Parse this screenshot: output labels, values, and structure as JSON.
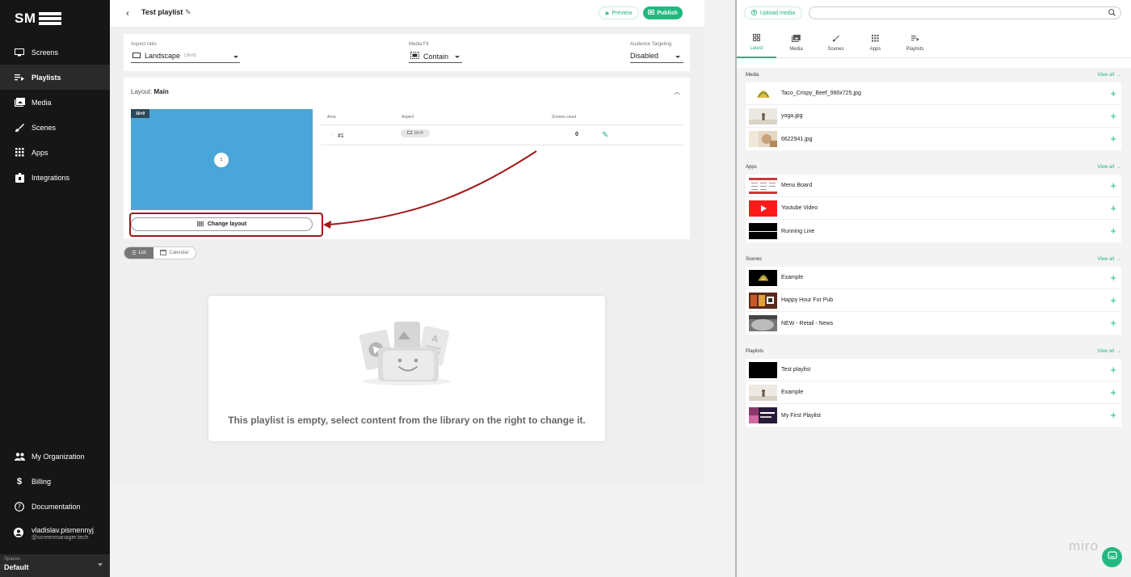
{
  "brand": {
    "logo_text": "SM"
  },
  "sidebar": {
    "items": [
      {
        "label": "Screens",
        "icon": "monitor-icon",
        "active": false
      },
      {
        "label": "Playlists",
        "icon": "playlist-icon",
        "active": true
      },
      {
        "label": "Media",
        "icon": "media-icon",
        "active": false
      },
      {
        "label": "Scenes",
        "icon": "brush-icon",
        "active": false
      },
      {
        "label": "Apps",
        "icon": "apps-grid-icon",
        "active": false
      },
      {
        "label": "Integrations",
        "icon": "integrations-icon",
        "active": false
      }
    ],
    "bottom_items": [
      {
        "label": "My Organization",
        "icon": "people-icon"
      },
      {
        "label": "Billing",
        "icon": "dollar-icon"
      },
      {
        "label": "Documentation",
        "icon": "help-icon"
      }
    ],
    "user": {
      "name": "vladislav.pismennyj",
      "email": "@screenmanager.tech"
    },
    "spaces": {
      "label": "Spaces",
      "value": "Default"
    }
  },
  "header": {
    "title": "Test playlist",
    "preview_label": "Preview",
    "publish_label": "Publish"
  },
  "settings": {
    "aspect_ratio": {
      "label": "Aspect ratio",
      "value": "Landscape",
      "note": "(16×9)"
    },
    "media_fit": {
      "label": "Media Fit",
      "value": "Contain"
    },
    "audience_targeting": {
      "label": "Audience Targeting",
      "value": "Disabled"
    }
  },
  "layout": {
    "prefix": "Layout:",
    "name": "Main",
    "ratio_tag": "16×9",
    "area_number": "1",
    "change_layout_label": "Change layout",
    "columns": [
      "Area",
      "Aspect",
      "Scenes count"
    ],
    "rows": [
      {
        "area": "#1",
        "aspect": "16×9",
        "scenes_count": "0"
      }
    ]
  },
  "view_toggle": {
    "list_label": "List",
    "calendar_label": "Calendar"
  },
  "empty_state": {
    "message": "This playlist is empty, select content from the library on the right to change it."
  },
  "library": {
    "upload_label": "Upload media",
    "search_placeholder": "",
    "tabs": [
      {
        "label": "Latest",
        "icon": "grid-icon",
        "active": true
      },
      {
        "label": "Media",
        "icon": "media-icon",
        "active": false
      },
      {
        "label": "Scenes",
        "icon": "brush-icon",
        "active": false
      },
      {
        "label": "Apps",
        "icon": "apps-grid-icon",
        "active": false
      },
      {
        "label": "Playlists",
        "icon": "playlist-icon",
        "active": false
      }
    ],
    "view_all_label": "View all",
    "sections": [
      {
        "title": "Media",
        "items": [
          "Taco_Crispy_Beef_990x725.jpg",
          "yoga.jpg",
          "6622941.jpg"
        ]
      },
      {
        "title": "Apps",
        "items": [
          "Menu Board",
          "Youtube Video",
          "Running Line"
        ]
      },
      {
        "title": "Scenes",
        "items": [
          "Example",
          "Happy Hour For Pub",
          "NEW - Retail - News"
        ]
      },
      {
        "title": "Playlists",
        "items": [
          "Test playlist",
          "Example",
          "My First Playlist"
        ]
      }
    ]
  },
  "watermark": "miro",
  "colors": {
    "accent": "#21b97f",
    "sidebar_bg": "#161616",
    "layout_preview": "#4aa6d8",
    "annotation": "#a01818"
  }
}
